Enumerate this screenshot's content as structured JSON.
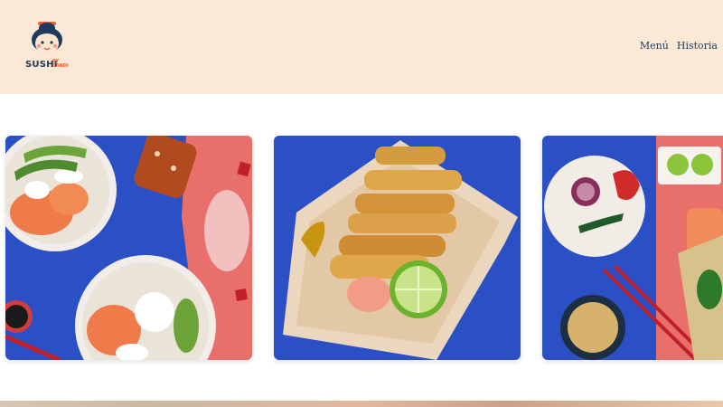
{
  "brand": {
    "name": "SUSHI",
    "tagline_top": "BY",
    "tagline_bottom": "CANDI"
  },
  "nav": {
    "items": [
      "Menú",
      "Historia"
    ]
  },
  "colors": {
    "header_bg": "#fbe9d6",
    "nav_text": "#1f3a5c",
    "accent": "#e6623e",
    "photo_blue": "#2b4fc4",
    "photo_coral": "#e9706a"
  },
  "gallery": {
    "photos": [
      "poke-bowls-photo",
      "fried-tempura-photo",
      "ingredients-photo"
    ]
  }
}
